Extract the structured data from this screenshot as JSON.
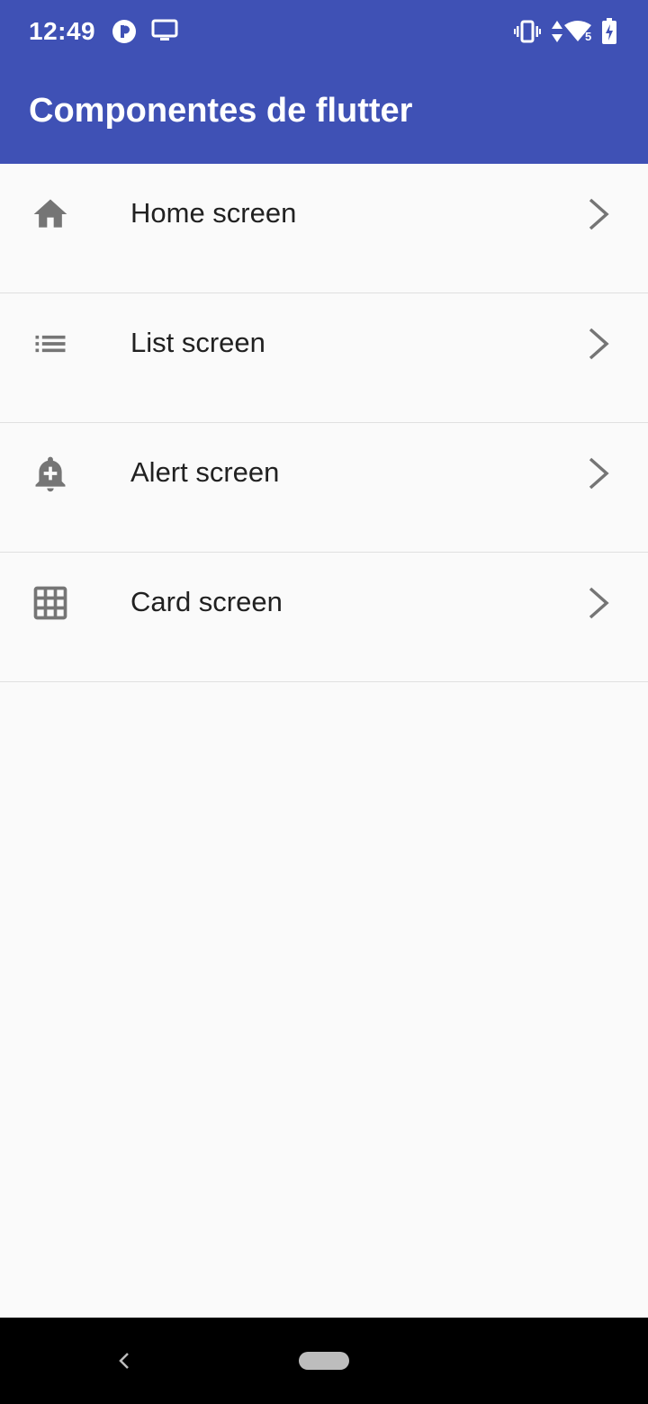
{
  "status_bar": {
    "time": "12:49",
    "left_icons": [
      "pocket-casts-icon",
      "cast-screen-icon"
    ],
    "right_icons": [
      "vibrate-icon",
      "data-arrows-icon",
      "wifi-icon",
      "battery-charging-icon"
    ],
    "wifi_badge": "5"
  },
  "app_bar": {
    "title": "Componentes de flutter",
    "color": "#3f51b5"
  },
  "list": {
    "items": [
      {
        "label": "Home screen",
        "icon": "home-icon",
        "trailing_icon": "chevron-right-icon"
      },
      {
        "label": "List screen",
        "icon": "list-icon",
        "trailing_icon": "chevron-right-icon"
      },
      {
        "label": "Alert screen",
        "icon": "add-alert-icon",
        "trailing_icon": "chevron-right-icon"
      },
      {
        "label": "Card screen",
        "icon": "grid-icon",
        "trailing_icon": "chevron-right-icon"
      }
    ]
  },
  "nav_bar": {
    "back_icon": "back-icon",
    "home_icon": "home-pill-icon"
  }
}
